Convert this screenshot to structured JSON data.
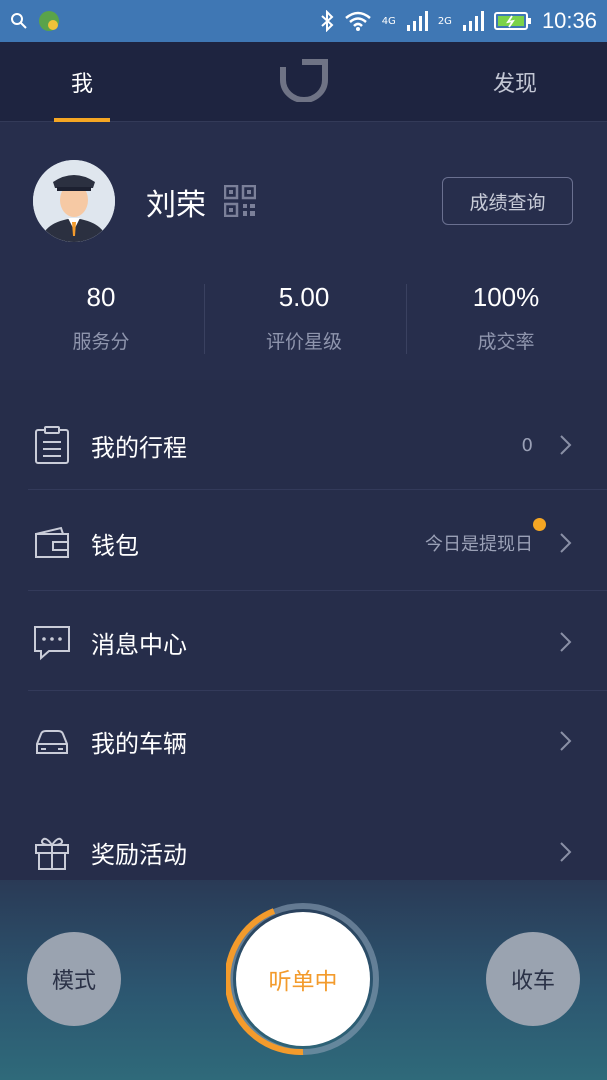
{
  "status_bar": {
    "time": "10:36",
    "net1": "4G",
    "net2": "2G"
  },
  "top_nav": {
    "tab_me": "我",
    "tab_discover": "发现",
    "active_color": "#f5a623"
  },
  "profile": {
    "name": "刘荣",
    "score_query_button": "成绩查询",
    "stats": [
      {
        "value": "80",
        "label": "服务分"
      },
      {
        "value": "5.00",
        "label": "评价星级"
      },
      {
        "value": "100%",
        "label": "成交率"
      }
    ]
  },
  "menu": {
    "trips": {
      "label": "我的行程",
      "value": "0"
    },
    "wallet": {
      "label": "钱包",
      "value": "今日是提现日"
    },
    "messages": {
      "label": "消息中心"
    },
    "vehicle": {
      "label": "我的车辆"
    },
    "rewards": {
      "label": "奖励活动"
    }
  },
  "bottom_bar": {
    "mode_button": "模式",
    "listening_button": "听单中",
    "finish_button": "收车",
    "accent_color": "#f39b2c"
  }
}
